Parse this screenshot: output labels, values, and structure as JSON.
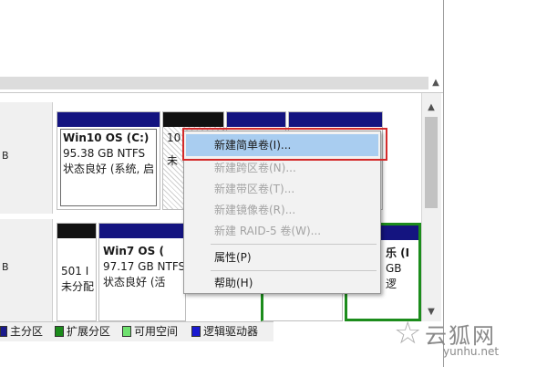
{
  "disks": [
    {
      "label": "B"
    },
    {
      "label": "B"
    }
  ],
  "partitions": {
    "win10": {
      "title": "Win10 OS  (C:)",
      "size": "95.38 GB NTFS",
      "status": "状态良好 (系统, 启"
    },
    "unalloc_small": {
      "line1": "10",
      "line2": "未"
    },
    "win7_left": {
      "line1": "501 I",
      "line2": "未分配"
    },
    "win7": {
      "title": "Win7 OS  (",
      "size": "97.17 GB NTFS",
      "status": "状态良好 (活"
    },
    "right_fun": {
      "title": "乐  (I",
      "size": "GB",
      "status": "逻"
    }
  },
  "context_menu": {
    "items": [
      {
        "label": "新建简单卷(I)...",
        "state": "hover"
      },
      {
        "label": "新建跨区卷(N)...",
        "state": "disabled"
      },
      {
        "label": "新建带区卷(T)...",
        "state": "disabled"
      },
      {
        "label": "新建镜像卷(R)...",
        "state": "disabled"
      },
      {
        "label": "新建 RAID-5 卷(W)...",
        "state": "disabled"
      },
      {
        "label": "属性(P)",
        "state": "enabled"
      },
      {
        "label": "帮助(H)",
        "state": "enabled"
      }
    ]
  },
  "legend": [
    {
      "label": "主分区",
      "color": "#1a1a8c"
    },
    {
      "label": "扩展分区",
      "color": "#1c8c1c"
    },
    {
      "label": "可用空间",
      "color": "#6fe06f"
    },
    {
      "label": "逻辑驱动器",
      "color": "#1a1ad0"
    }
  ],
  "watermark": {
    "text": "云狐网",
    "url": "yunhu.net"
  },
  "colors": {
    "highlight_frame": "#d32a2a",
    "menu_hover": "#a9cdf0",
    "primary_bar": "#141480"
  }
}
